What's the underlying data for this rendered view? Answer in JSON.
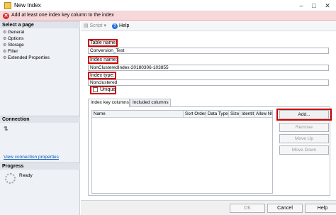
{
  "window": {
    "title": "New Index"
  },
  "error": {
    "message": "Add at least one index key column to the index"
  },
  "left_pane": {
    "select_page_header": "Select a page",
    "pages": [
      "General",
      "Options",
      "Storage",
      "Filter",
      "Extended Properties"
    ],
    "connection_header": "Connection",
    "view_connection_link": "View connection properties",
    "progress_header": "Progress",
    "progress_status": "Ready"
  },
  "toolbar": {
    "script_label": "Script",
    "help_label": "Help"
  },
  "form": {
    "table_name_label": "Table name:",
    "table_name_value": "Conversion_Test",
    "index_name_label": "Index name:",
    "index_name_value": "NonClusteredIndex-20180306-103855",
    "index_type_label": "Index type:",
    "index_type_value": "Nonclustered",
    "unique_label": "Unique",
    "unique_checked": false
  },
  "tabs": [
    "Index key columns",
    "Included columns"
  ],
  "grid": {
    "columns": [
      "Name",
      "Sort Order",
      "Data Type",
      "Size",
      "Identity",
      "Allow NULLs"
    ]
  },
  "side_buttons": {
    "add": "Add...",
    "remove": "Remove",
    "move_up": "Move Up",
    "move_down": "Move Down"
  },
  "footer": {
    "ok": "OK",
    "cancel": "Cancel",
    "help": "Help"
  },
  "colors": {
    "highlight_border": "#cc0000",
    "error_background": "#f8d7da",
    "link": "#0b5cb8"
  }
}
